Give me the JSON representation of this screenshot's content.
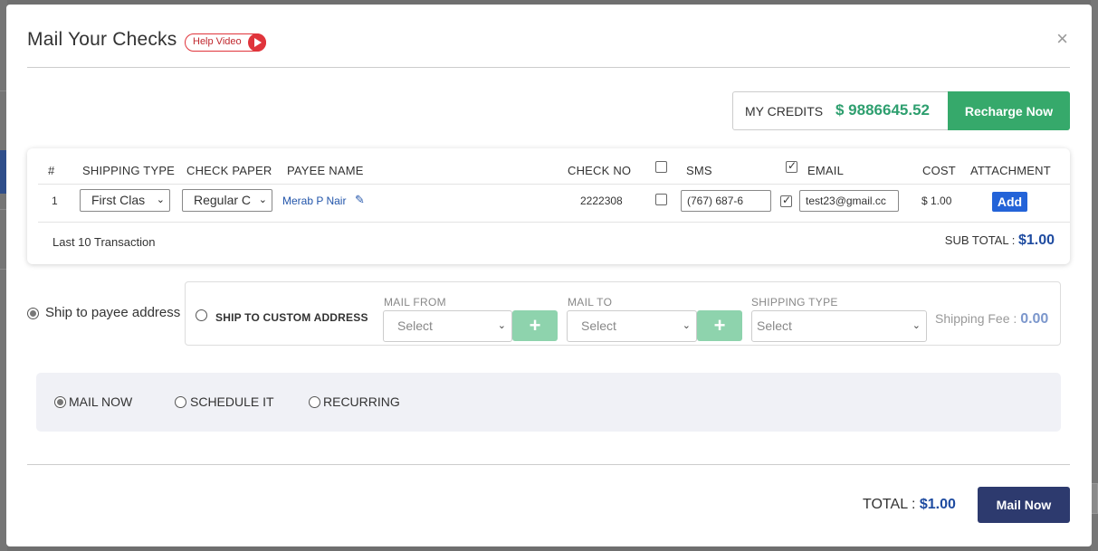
{
  "modal": {
    "title": "Mail Your Checks",
    "help_label": "Help Video",
    "close_glyph": "×"
  },
  "credits": {
    "label": "MY CREDITS",
    "value": "$ 9886645.52",
    "recharge_label": "Recharge Now"
  },
  "table": {
    "headers": {
      "index": "#",
      "shipping_type": "SHIPPING TYPE",
      "check_paper": "CHECK PAPER",
      "payee_name": "PAYEE NAME",
      "check_no": "CHECK NO",
      "sms": "SMS",
      "email": "EMAIL",
      "cost": "COST",
      "attachment": "ATTACHMENT"
    },
    "header_sms_checked": false,
    "header_email_checked": true,
    "rows": [
      {
        "index": "1",
        "shipping_type": "First Clas",
        "check_paper": "Regular C",
        "payee_name": "Merab P Nair",
        "check_no": "2222308",
        "sms_checked": false,
        "sms_value": "(767) 687-6",
        "email_checked": true,
        "email_value": "test23@gmail.cc",
        "cost": "$ 1.00",
        "attachment_label": "Add"
      }
    ],
    "last_transactions_label": "Last 10 Transaction",
    "subtotal_label": "SUB TOTAL :",
    "subtotal_value": "$1.00"
  },
  "shipping": {
    "payee_address_label": "Ship to payee address",
    "payee_address_selected": true,
    "custom_address_label": "SHIP TO CUSTOM ADDRESS",
    "mail_from_label": "MAIL FROM",
    "mail_from_value": "Select",
    "mail_to_label": "MAIL TO",
    "mail_to_value": "Select",
    "shipping_type_label": "SHIPPING TYPE",
    "shipping_type_value": "Select",
    "fee_label": "Shipping Fee :",
    "fee_value": "0.00"
  },
  "schedule": {
    "options": [
      "MAIL NOW",
      "SCHEDULE IT",
      "RECURRING"
    ],
    "selected": "MAIL NOW"
  },
  "footer": {
    "total_label": "TOTAL :",
    "total_value": "$1.00",
    "mail_now_label": "Mail Now"
  },
  "colors": {
    "credits_value": "#2e9f6f",
    "recharge_button": "#36a96b",
    "add_button": "#2363d8",
    "mail_now_button": "#2d3a6e",
    "help_accent": "#e0343b",
    "total_value": "#1e4ba0"
  }
}
